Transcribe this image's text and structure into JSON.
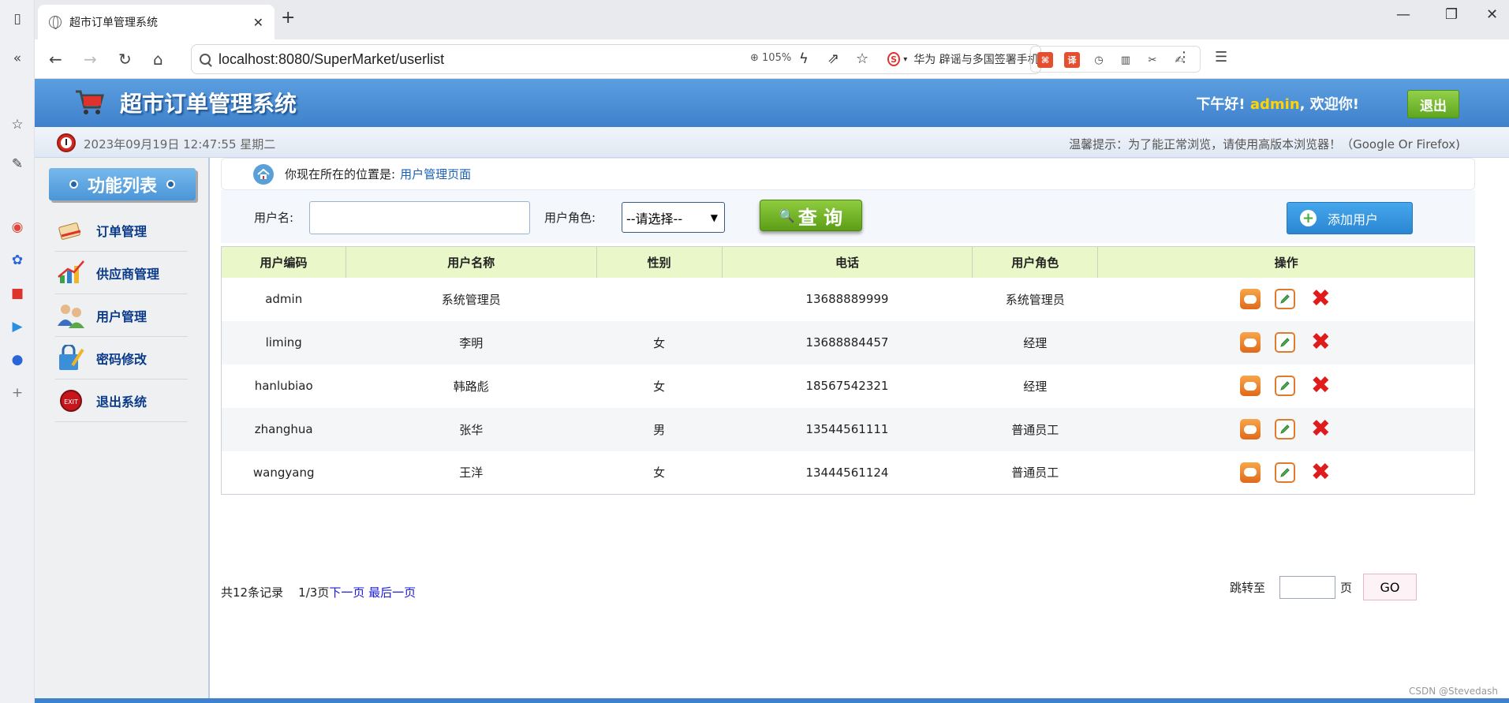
{
  "browser": {
    "tab_title": "超市订单管理系统",
    "url": "localhost:8080/SuperMarket/userlist",
    "zoom": "105%",
    "hot_search": "华为 辟谣与多国签署手机录",
    "hot_badge": "S"
  },
  "header": {
    "title": "超市订单管理系统",
    "greeting": "下午好!",
    "username": "admin",
    "welcome": ", 欢迎你!",
    "logout_label": "退出"
  },
  "infobar": {
    "datetime": "2023年09月19日 12:47:55 星期二",
    "tip": "温馨提示：为了能正常浏览，请使用高版本浏览器！（Google Or Firefox)"
  },
  "sidebar": {
    "title": "功能列表",
    "items": [
      {
        "label": "订单管理",
        "icon": "order-icon"
      },
      {
        "label": "供应商管理",
        "icon": "supplier-icon"
      },
      {
        "label": "用户管理",
        "icon": "users-icon"
      },
      {
        "label": "密码修改",
        "icon": "password-icon"
      },
      {
        "label": "退出系统",
        "icon": "exit-icon"
      }
    ]
  },
  "breadcrumb": {
    "prefix": "你现在所在的位置是:",
    "current": "用户管理页面"
  },
  "search": {
    "username_label": "用户名:",
    "username_value": "",
    "role_label": "用户角色:",
    "role_selected": "--请选择--",
    "query_label": "查 询",
    "add_label": "添加用户"
  },
  "table": {
    "columns": [
      "用户编码",
      "用户名称",
      "性别",
      "电话",
      "用户角色",
      "操作"
    ],
    "rows": [
      {
        "code": "admin",
        "name": "系统管理员",
        "gender": "",
        "phone": "13688889999",
        "role": "系统管理员"
      },
      {
        "code": "liming",
        "name": "李明",
        "gender": "女",
        "phone": "13688884457",
        "role": "经理"
      },
      {
        "code": "hanlubiao",
        "name": "韩路彪",
        "gender": "女",
        "phone": "18567542321",
        "role": "经理"
      },
      {
        "code": "zhanghua",
        "name": "张华",
        "gender": "男",
        "phone": "13544561111",
        "role": "普通员工"
      },
      {
        "code": "wangyang",
        "name": "王洋",
        "gender": "女",
        "phone": "13444561124",
        "role": "普通员工"
      }
    ]
  },
  "pager": {
    "total": "共12条记录",
    "page": "1/3页",
    "next": "下一页",
    "last": "最后一页",
    "jump_label": "跳转至",
    "page_unit": "页",
    "go_label": "GO"
  },
  "watermark": "CSDN @Stevedash",
  "colors": {
    "header_blue": "#3f82cc",
    "accent_green": "#5ea61f",
    "table_header_bg": "#e9f7c9",
    "username_yellow": "#ffd400",
    "link_blue": "#1a5fb4"
  }
}
